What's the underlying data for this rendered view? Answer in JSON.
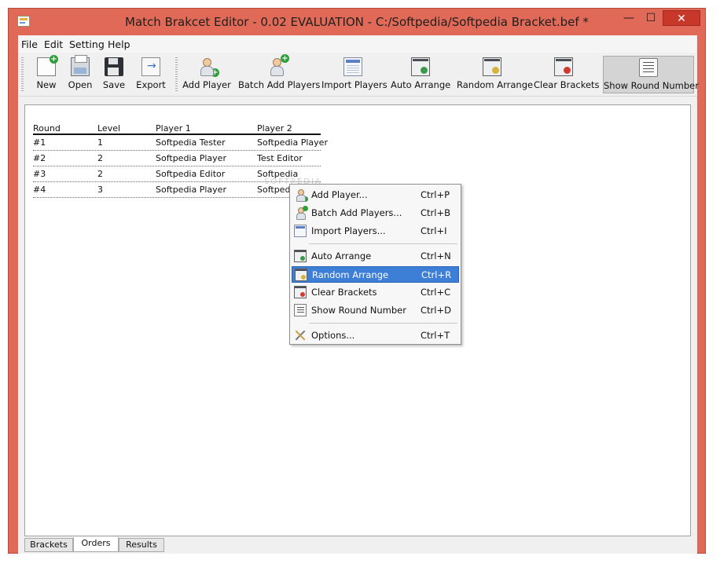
{
  "window": {
    "title": "Match Brakcet Editor - 0.02 EVALUATION - C:/Softpedia/Softpedia Bracket.bef *",
    "controls": {
      "minimize": "—",
      "maximize": "☐",
      "close": "✕"
    }
  },
  "menubar": [
    "File",
    "Edit",
    "Setting",
    "Help"
  ],
  "toolbar": {
    "new": "New",
    "open": "Open",
    "save": "Save",
    "export": "Export",
    "add_player": "Add Player",
    "batch_add_players": "Batch Add Players",
    "import_players": "Import Players",
    "auto_arrange": "Auto Arrange",
    "random_arrange": "Random Arrange",
    "clear_brackets": "Clear Brackets",
    "show_round_number": "Show Round Number",
    "active_item": "Show Round Number"
  },
  "table": {
    "headers": [
      "Round",
      "Level",
      "Player 1",
      "Player 2"
    ],
    "rows": [
      [
        "#1",
        "1",
        "Softpedia Tester",
        "Softpedia Player"
      ],
      [
        "#2",
        "2",
        "Softpedia Player",
        "Test Editor"
      ],
      [
        "#3",
        "2",
        "Softpedia Editor",
        "Softpedia"
      ],
      [
        "#4",
        "3",
        "Softpedia Player",
        "Softpedia"
      ]
    ]
  },
  "context_menu": {
    "items": [
      {
        "label": "Add Player...",
        "shortcut": "Ctrl+P"
      },
      {
        "label": "Batch Add Players...",
        "shortcut": "Ctrl+B"
      },
      {
        "label": "Import Players...",
        "shortcut": "Ctrl+I"
      },
      {
        "label": "Auto Arrange",
        "shortcut": "Ctrl+N"
      },
      {
        "label": "Random Arrange",
        "shortcut": "Ctrl+R"
      },
      {
        "label": "Clear Brackets",
        "shortcut": "Ctrl+C"
      },
      {
        "label": "Show Round Number",
        "shortcut": "Ctrl+D"
      },
      {
        "label": "Options...",
        "shortcut": "Ctrl+T"
      }
    ],
    "highlighted": "Random Arrange"
  },
  "tabs": [
    "Brackets",
    "Orders",
    "Results"
  ],
  "selected_tab": "Orders",
  "watermark": "SOFTPEDIA",
  "colors": {
    "title_bar": "#e06a57",
    "close_button": "#c7382b",
    "menu_highlight": "#3d7ed6"
  }
}
